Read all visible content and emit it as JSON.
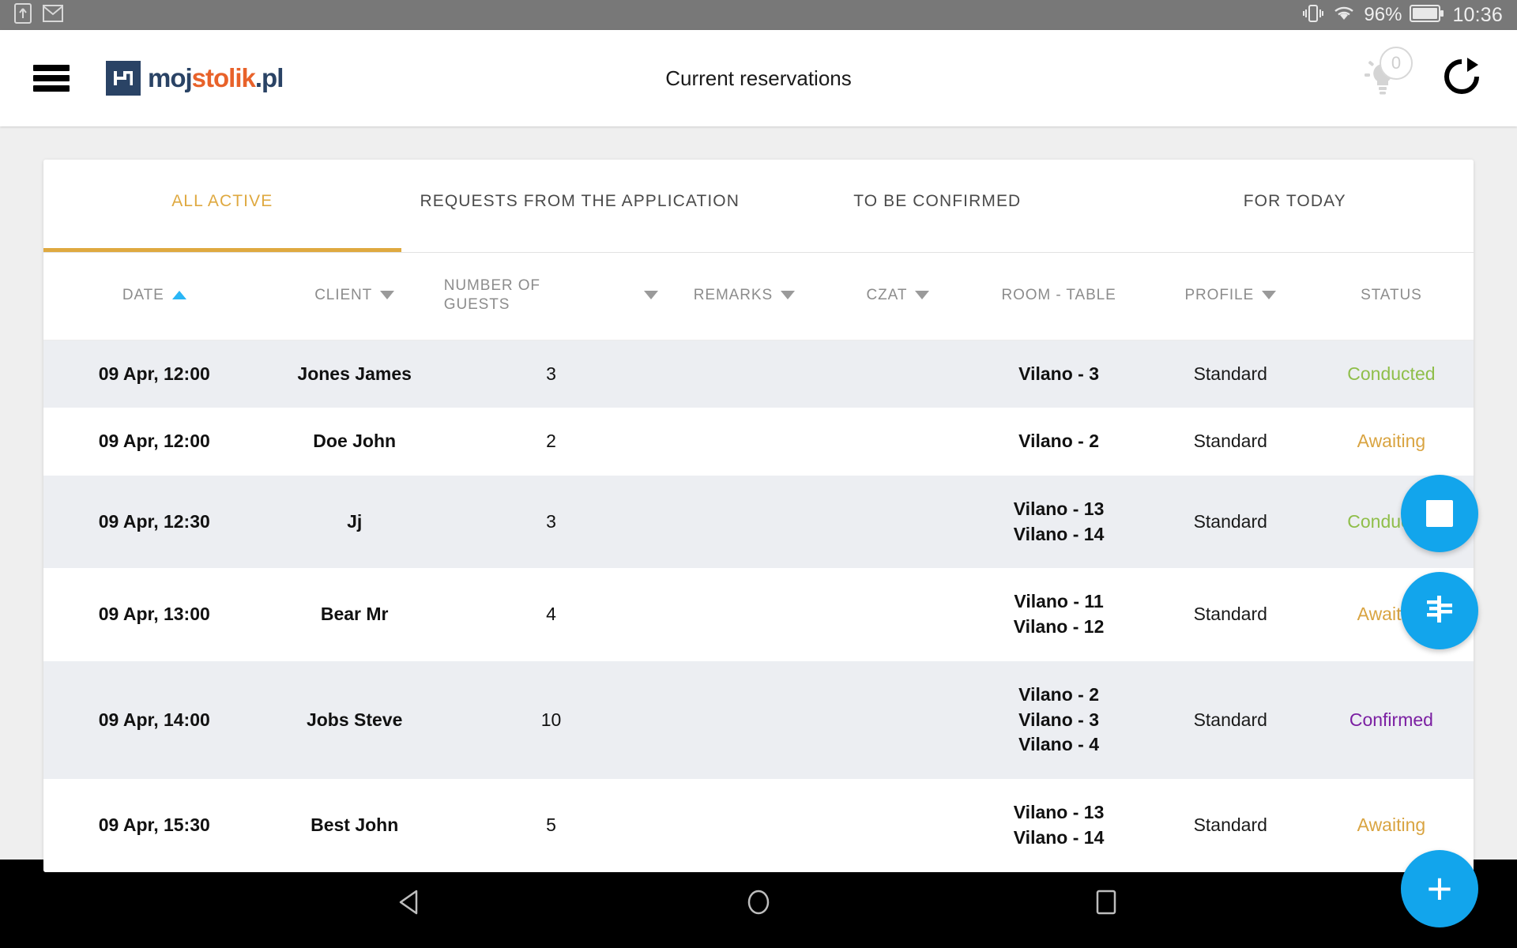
{
  "status_bar": {
    "vibrate_icon": "vibrate-icon",
    "share_icon": "screen-share-icon",
    "mail_icon": "gmail-icon",
    "wifi_icon": "wifi-icon",
    "battery_percent": "96%",
    "battery_icon": "battery-icon",
    "time": "10:36"
  },
  "app_bar": {
    "menu_icon": "hamburger-menu-icon",
    "logo": {
      "mark": "mojstolik-logo-mark",
      "part1": "moj",
      "part2": "stolik",
      "part3": ".pl"
    },
    "title": "Current reservations",
    "bulb_icon": "lightbulb-icon",
    "bulb_badge": "0",
    "refresh_icon": "refresh-icon"
  },
  "tabs": [
    {
      "label": "ALL ACTIVE",
      "active": true
    },
    {
      "label": "REQUESTS FROM THE APPLICATION",
      "active": false
    },
    {
      "label": "TO BE CONFIRMED",
      "active": false
    },
    {
      "label": "FOR TODAY",
      "active": false
    }
  ],
  "table": {
    "columns": [
      {
        "label": "DATE",
        "sort": "asc"
      },
      {
        "label": "CLIENT",
        "sort": "desc"
      },
      {
        "label": "NUMBER OF GUESTS",
        "sort": "desc"
      },
      {
        "label": "REMARKS",
        "sort": "desc"
      },
      {
        "label": "CZAT",
        "sort": "desc"
      },
      {
        "label": "ROOM - TABLE",
        "sort": "none"
      },
      {
        "label": "PROFILE",
        "sort": "desc"
      },
      {
        "label": "STATUS",
        "sort": "none"
      }
    ],
    "rows": [
      {
        "date": "09 Apr, 12:00",
        "client": "Jones James",
        "guests": "3",
        "remarks": "",
        "czat": "",
        "room": "Vilano - 3",
        "profile": "Standard",
        "status": "Conducted",
        "status_kind": "conducted"
      },
      {
        "date": "09 Apr, 12:00",
        "client": "Doe John",
        "guests": "2",
        "remarks": "",
        "czat": "",
        "room": "Vilano - 2",
        "profile": "Standard",
        "status": "Awaiting",
        "status_kind": "awaiting"
      },
      {
        "date": "09 Apr, 12:30",
        "client": "Jj",
        "guests": "3",
        "remarks": "",
        "czat": "",
        "room": "Vilano - 13\nVilano - 14",
        "profile": "Standard",
        "status": "Conducted",
        "status_kind": "conducted"
      },
      {
        "date": "09 Apr, 13:00",
        "client": "Bear Mr",
        "guests": "4",
        "remarks": "",
        "czat": "",
        "room": "Vilano - 11\nVilano - 12",
        "profile": "Standard",
        "status": "Awaiting",
        "status_kind": "awaiting"
      },
      {
        "date": "09 Apr, 14:00",
        "client": "Jobs Steve",
        "guests": "10",
        "remarks": "",
        "czat": "",
        "room": "Vilano - 2\nVilano - 3\nVilano - 4",
        "profile": "Standard",
        "status": "Confirmed",
        "status_kind": "confirmed"
      },
      {
        "date": "09 Apr, 15:30",
        "client": "Best John",
        "guests": "5",
        "remarks": "",
        "czat": "",
        "room": "Vilano - 13\nVilano - 14",
        "profile": "Standard",
        "status": "Awaiting",
        "status_kind": "awaiting"
      }
    ]
  },
  "fabs": [
    {
      "name": "stop-fab",
      "icon": "stop-square-icon"
    },
    {
      "name": "tables-fab",
      "icon": "table-layout-icon"
    },
    {
      "name": "add-fab",
      "icon": "plus-icon",
      "glyph": "+"
    }
  ],
  "nav_bar": {
    "back_icon": "back-triangle-icon",
    "home_icon": "home-circle-icon",
    "recents_icon": "recents-square-icon"
  },
  "colors": {
    "accent_gold": "#dfa940",
    "fab_blue": "#12a5ec",
    "conducted_green": "#8fbe4a",
    "awaiting_gold": "#d9a441",
    "confirmed_purple": "#7b1fa2",
    "logo_navy": "#2a4365",
    "logo_orange": "#e8622a",
    "page_bg": "#efefef",
    "row_alt_bg": "#eceef2"
  }
}
